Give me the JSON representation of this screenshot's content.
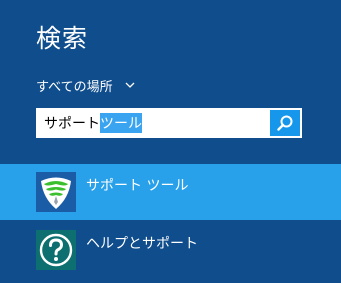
{
  "search_pane": {
    "title": "検索",
    "scope_label": "すべての場所",
    "query_plain": "サポート",
    "query_selected": "ツール",
    "button_icon": "search-icon"
  },
  "results": [
    {
      "label": "サポート ツール",
      "icon": "shield-app-icon",
      "selected": true
    },
    {
      "label": "ヘルプとサポート",
      "icon": "help-question-icon",
      "selected": false
    }
  ],
  "colors": {
    "background": "#0f4d8c",
    "selected_row": "#29a1ea",
    "search_button": "#1797ec",
    "text_selection": "#3aa4f0",
    "help_tile": "#0d6f6f"
  }
}
